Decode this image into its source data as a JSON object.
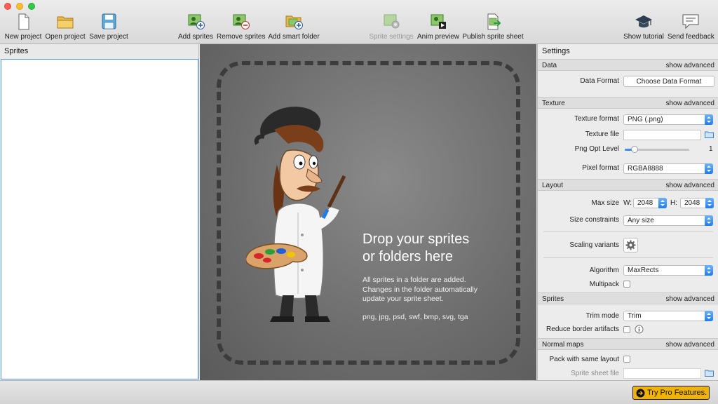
{
  "toolbar": {
    "new_project": "New project",
    "open_project": "Open project",
    "save_project": "Save project",
    "add_sprites": "Add sprites",
    "remove_sprites": "Remove sprites",
    "add_smart_folder": "Add smart folder",
    "sprite_settings": "Sprite settings",
    "anim_preview": "Anim preview",
    "publish_sprite_sheet": "Publish sprite sheet",
    "show_tutorial": "Show tutorial",
    "send_feedback": "Send feedback"
  },
  "sprites_panel": {
    "title": "Sprites"
  },
  "canvas": {
    "title_line1": "Drop your sprites",
    "title_line2": "or folders here",
    "desc_line1": "All sprites in a folder are added.",
    "desc_line2": "Changes in the folder automatically",
    "desc_line3": "update your sprite sheet.",
    "formats": "png, jpg, psd, swf, bmp, svg, tga"
  },
  "settings": {
    "title": "Settings",
    "advanced_label": "show advanced",
    "data": {
      "header": "Data",
      "data_format_label": "Data Format",
      "data_format_button": "Choose Data Format"
    },
    "texture": {
      "header": "Texture",
      "texture_format_label": "Texture format",
      "texture_format_value": "PNG (.png)",
      "texture_file_label": "Texture file",
      "texture_file_value": "",
      "png_opt_label": "Png Opt Level",
      "png_opt_value": "1",
      "pixel_format_label": "Pixel format",
      "pixel_format_value": "RGBA8888"
    },
    "layout": {
      "header": "Layout",
      "max_size_label": "Max size",
      "w_label": "W:",
      "w_value": "2048",
      "h_label": "H:",
      "h_value": "2048",
      "size_constraints_label": "Size constraints",
      "size_constraints_value": "Any size",
      "scaling_variants_label": "Scaling variants",
      "algorithm_label": "Algorithm",
      "algorithm_value": "MaxRects",
      "multipack_label": "Multipack"
    },
    "sprites": {
      "header": "Sprites",
      "trim_mode_label": "Trim mode",
      "trim_mode_value": "Trim",
      "reduce_border_label": "Reduce border artifacts"
    },
    "normal_maps": {
      "header": "Normal maps",
      "pack_same_layout_label": "Pack with same layout",
      "sprite_sheet_file_label": "Sprite sheet file",
      "sprite_sheet_file_value": ""
    }
  },
  "bottom": {
    "pro_button": "Try Pro Features."
  },
  "colors": {
    "accent": "#1f7cf0",
    "pro": "#f0b400"
  }
}
